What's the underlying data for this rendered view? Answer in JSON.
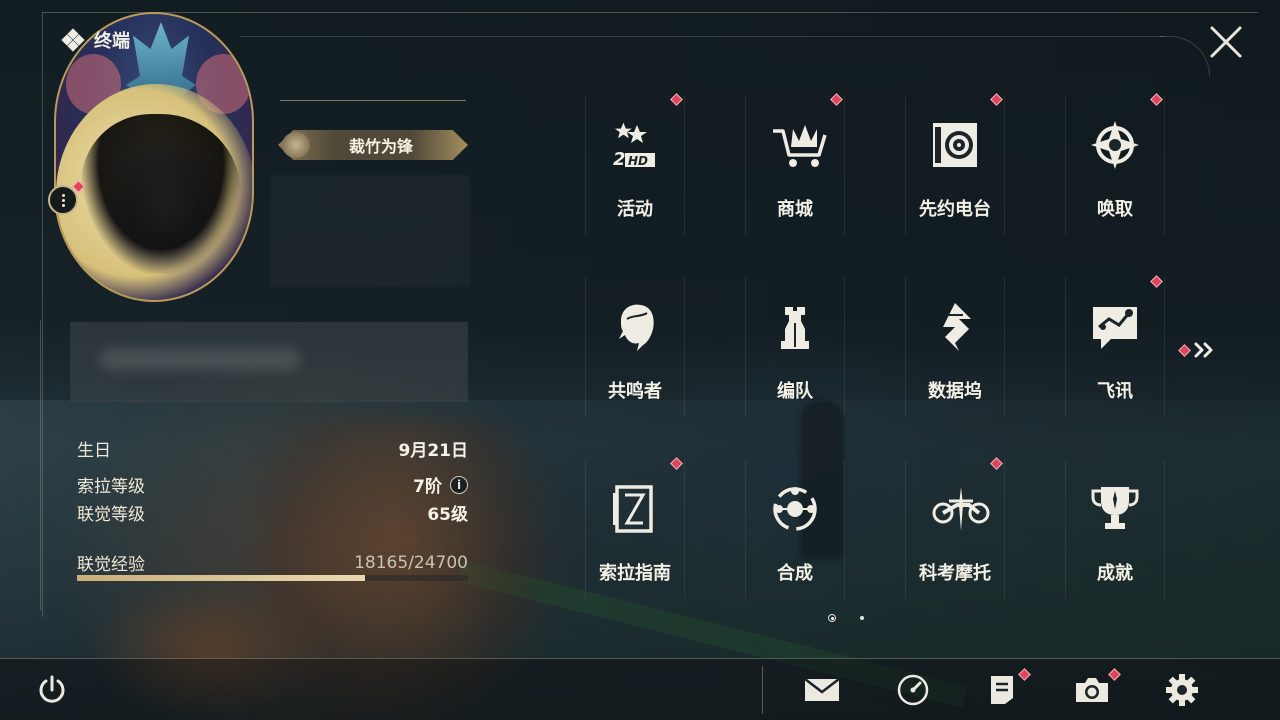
{
  "header": {
    "title": "终端"
  },
  "profile": {
    "title_plate": "裁竹为锋",
    "stats": [
      {
        "label": "生日",
        "value": "9月21日"
      },
      {
        "label": "索拉等级",
        "value": "7阶"
      },
      {
        "label": "联觉等级",
        "value": "65级"
      },
      {
        "label": "联觉经验",
        "value": "18165/24700"
      }
    ],
    "exp_current": 18165,
    "exp_max": 24700
  },
  "menu": {
    "items": [
      {
        "label": "活动",
        "icon": "event-2hd-icon",
        "badge": true
      },
      {
        "label": "商城",
        "icon": "shop-cart-icon",
        "badge": true
      },
      {
        "label": "先约电台",
        "icon": "radio-icon",
        "badge": true
      },
      {
        "label": "唤取",
        "icon": "convene-icon",
        "badge": true
      },
      {
        "label": "共鸣者",
        "icon": "resonator-icon",
        "badge": false
      },
      {
        "label": "编队",
        "icon": "team-icon",
        "badge": false
      },
      {
        "label": "数据坞",
        "icon": "data-bank-icon",
        "badge": false
      },
      {
        "label": "飞讯",
        "icon": "message-icon",
        "badge": true
      },
      {
        "label": "索拉指南",
        "icon": "guidebook-icon",
        "badge": true
      },
      {
        "label": "合成",
        "icon": "synthesis-icon",
        "badge": false
      },
      {
        "label": "科考摩托",
        "icon": "motorcycle-icon",
        "badge": true
      },
      {
        "label": "成就",
        "icon": "trophy-icon",
        "badge": false
      }
    ],
    "pages_total": 2,
    "page_current": 1
  },
  "bottom_bar": {
    "buttons": [
      {
        "name": "power",
        "icon": "power-icon"
      },
      {
        "name": "mail",
        "icon": "mail-icon"
      },
      {
        "name": "clock",
        "icon": "clock-icon"
      },
      {
        "name": "notes",
        "icon": "notes-icon",
        "badge": true
      },
      {
        "name": "camera",
        "icon": "camera-icon",
        "badge": true
      },
      {
        "name": "settings",
        "icon": "gear-icon"
      }
    ]
  },
  "colors": {
    "accent_gold": "#c9ae7a",
    "badge_red": "#e0445a",
    "text": "#f3f0e6"
  }
}
